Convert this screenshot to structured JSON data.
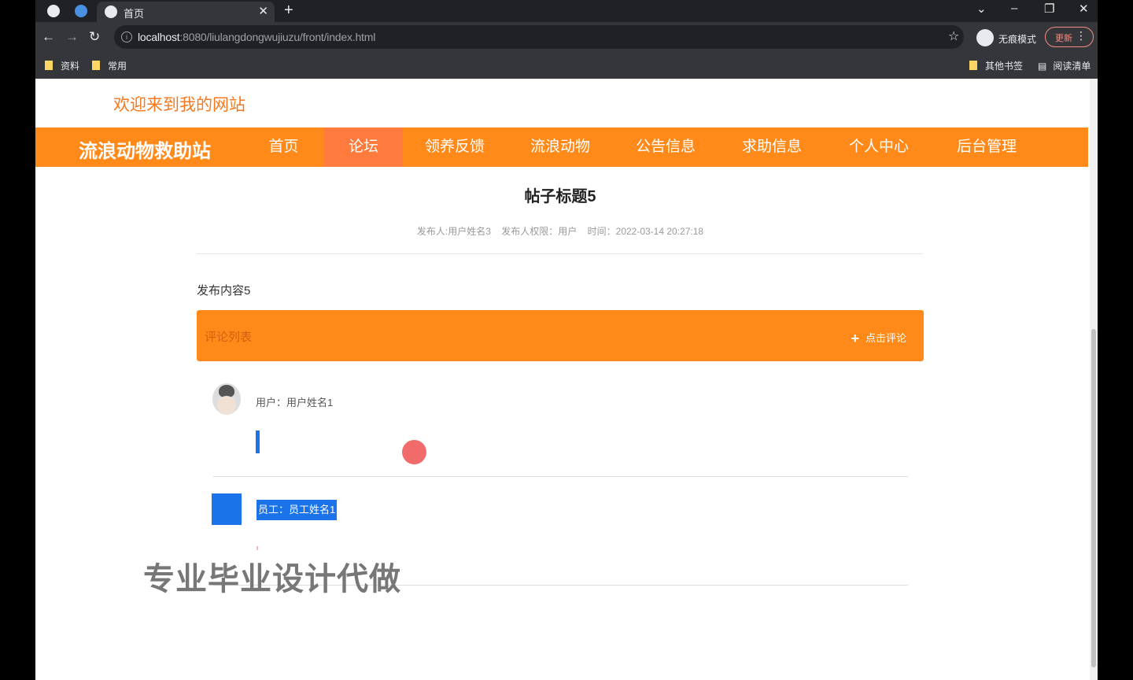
{
  "browser": {
    "tab_title": "首页",
    "url_host": "localhost",
    "url_path": ":8080/liulangdongwujiuzu/front/index.html",
    "incognito_label": "无痕模式",
    "update_label": "更新",
    "bookmarks": [
      "资料",
      "常用"
    ],
    "bookmarks_right": [
      "其他书签",
      "阅读清单"
    ]
  },
  "site": {
    "welcome": "欢迎来到我的网站",
    "title": "流浪动物救助站",
    "nav": [
      {
        "label": "首页",
        "active": false
      },
      {
        "label": "论坛",
        "active": true
      },
      {
        "label": "领养反馈",
        "active": false
      },
      {
        "label": "流浪动物",
        "active": false
      },
      {
        "label": "公告信息",
        "active": false
      },
      {
        "label": "求助信息",
        "active": false
      },
      {
        "label": "个人中心",
        "active": false
      },
      {
        "label": "后台管理",
        "active": false
      }
    ]
  },
  "post": {
    "title": "帖子标题5",
    "author": "发布人:用户姓名3",
    "role": "发布人权限：用户",
    "time": "时间：2022-03-14 20:27:18",
    "content": "发布内容5"
  },
  "comments": {
    "header": "评论列表",
    "add_label": "点击评论",
    "items": [
      {
        "user": "用户：用户姓名1"
      },
      {
        "user": "员工：员工姓名1"
      }
    ]
  },
  "watermark": "专业毕业设计代做",
  "colors": {
    "accent": "#ff8a1a",
    "welcome": "#f47920",
    "active_tab": "#ff7a3d"
  }
}
